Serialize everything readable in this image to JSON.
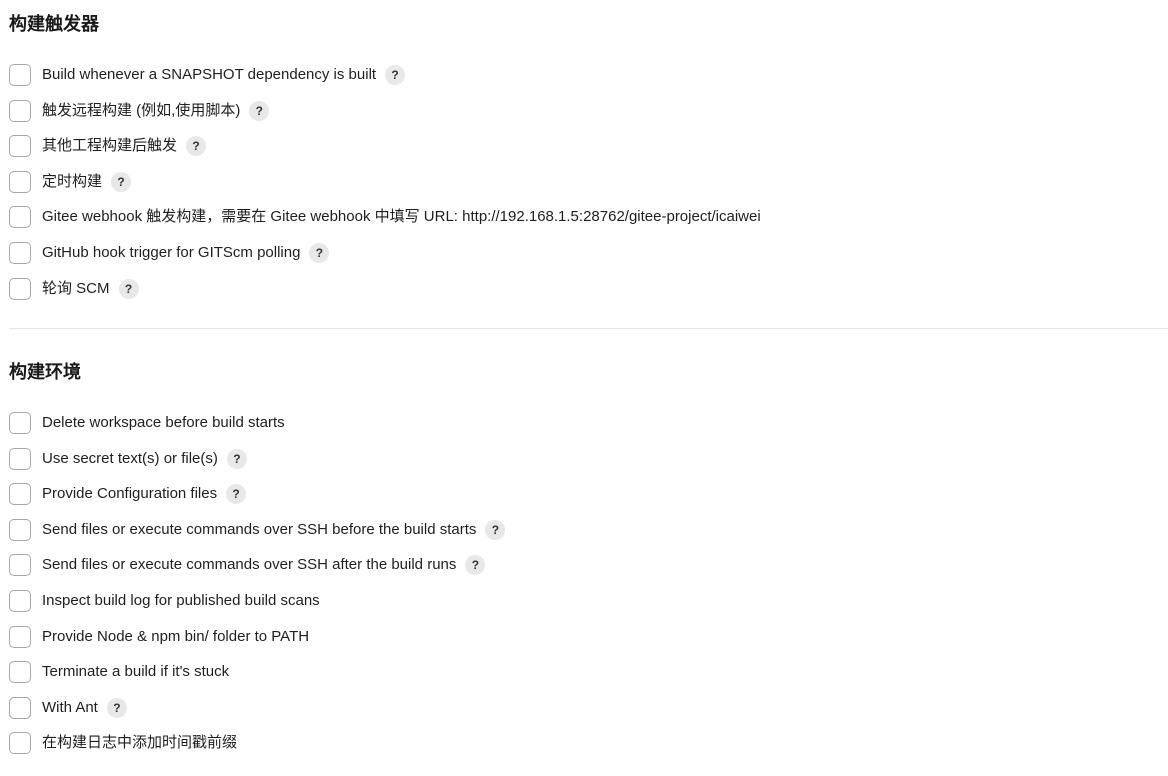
{
  "build_triggers": {
    "title": "构建触发器",
    "items": [
      {
        "label": "Build whenever a SNAPSHOT dependency is built",
        "help": "?",
        "has_help": true,
        "checked": false
      },
      {
        "label": "触发远程构建 (例如,使用脚本)",
        "help": "?",
        "has_help": true,
        "checked": false
      },
      {
        "label": "其他工程构建后触发",
        "help": "?",
        "has_help": true,
        "checked": false
      },
      {
        "label": "定时构建",
        "help": "?",
        "has_help": true,
        "checked": false
      },
      {
        "label": "Gitee webhook 触发构建，需要在 Gitee webhook 中填写 URL: http://192.168.1.5:28762/gitee-project/icaiwei",
        "help": "",
        "has_help": false,
        "checked": false
      },
      {
        "label": "GitHub hook trigger for GITScm polling",
        "help": "?",
        "has_help": true,
        "checked": false
      },
      {
        "label": "轮询 SCM",
        "help": "?",
        "has_help": true,
        "checked": false
      }
    ]
  },
  "build_environment": {
    "title": "构建环境",
    "items": [
      {
        "label": "Delete workspace before build starts",
        "help": "",
        "has_help": false,
        "checked": false
      },
      {
        "label": "Use secret text(s) or file(s)",
        "help": "?",
        "has_help": true,
        "checked": false
      },
      {
        "label": "Provide Configuration files",
        "help": "?",
        "has_help": true,
        "checked": false
      },
      {
        "label": "Send files or execute commands over SSH before the build starts",
        "help": "?",
        "has_help": true,
        "checked": false
      },
      {
        "label": "Send files or execute commands over SSH after the build runs",
        "help": "?",
        "has_help": true,
        "checked": false
      },
      {
        "label": "Inspect build log for published build scans",
        "help": "",
        "has_help": false,
        "checked": false
      },
      {
        "label": "Provide Node & npm bin/ folder to PATH",
        "help": "",
        "has_help": false,
        "checked": false
      },
      {
        "label": "Terminate a build if it's stuck",
        "help": "",
        "has_help": false,
        "checked": false
      },
      {
        "label": "With Ant",
        "help": "?",
        "has_help": true,
        "checked": false
      },
      {
        "label": "在构建日志中添加时间戳前缀",
        "help": "",
        "has_help": false,
        "checked": false
      }
    ]
  },
  "colors": {
    "checkbox_border": "#a7a7a7",
    "help_badge_bg": "#e8e8e8",
    "divider": "#e6e6e6",
    "text": "#1f1f1f"
  }
}
